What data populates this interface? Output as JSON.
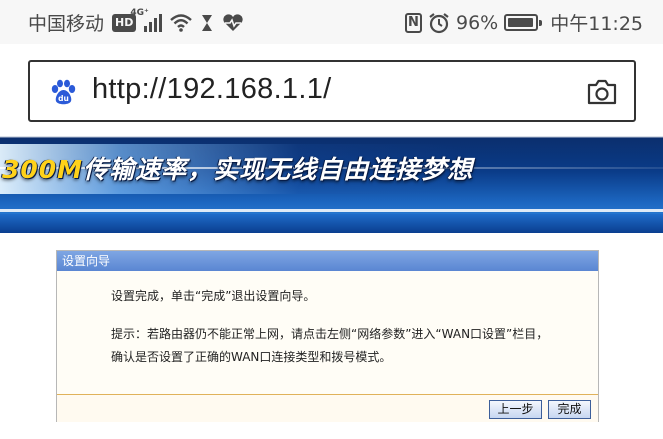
{
  "status_bar": {
    "carrier": "中国移动",
    "hd_badge": "HD",
    "network": "4G⁺",
    "battery": "96%",
    "battery_level": 0.96,
    "time": "中午11:25",
    "icons": [
      "hd-icon",
      "signal-icon",
      "wifi-icon",
      "hourglass-icon",
      "heart-rate-icon",
      "nfc-icon",
      "alarm-icon",
      "battery-icon"
    ]
  },
  "browser": {
    "url": "http://192.168.1.1/",
    "left_icon": "baidu-paw-icon",
    "right_icon": "camera-icon"
  },
  "banner": {
    "slogan_accent": "300M",
    "slogan": "传输速率，实现无线自由连接梦想"
  },
  "wizard": {
    "title": "设置向导",
    "message": "设置完成，单击“完成”退出设置向导。",
    "hint": "提示：若路由器仍不能正常上网，请点击左侧“网络参数”进入“WAN口设置”栏目，确认是否设置了正确的WAN口连接类型和拨号模式。",
    "prev_button": "上一步",
    "finish_button": "完成"
  },
  "colors": {
    "banner_blue": "#0a3b88",
    "wizard_header": "#6f98dc",
    "wizard_border": "#e0b25a",
    "accent_yellow": "#ffd21a"
  }
}
